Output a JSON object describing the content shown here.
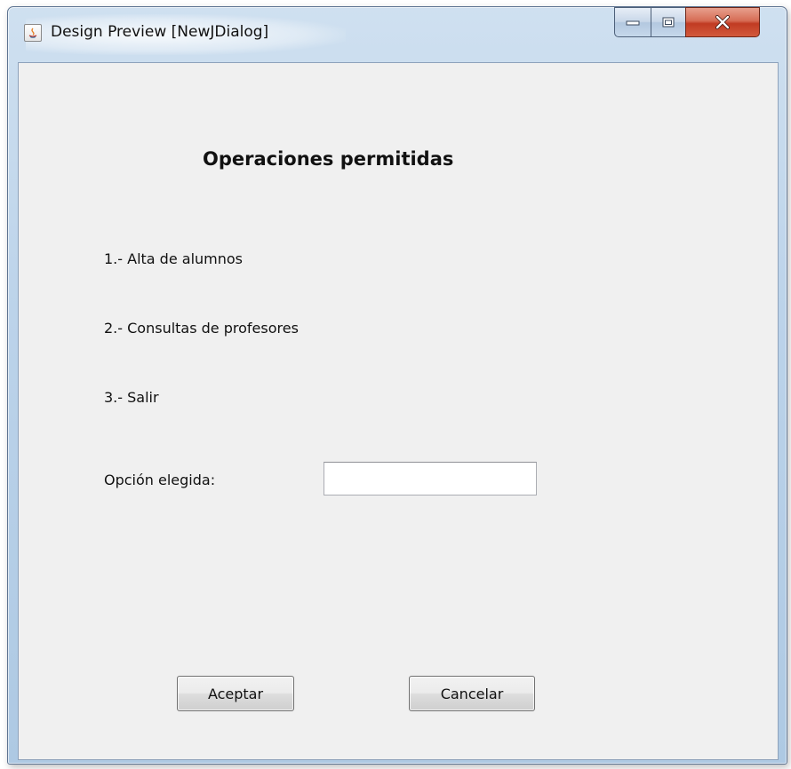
{
  "window": {
    "title": "Design Preview [NewJDialog]",
    "controls": {
      "minimize_icon": "minimize-icon",
      "maximize_icon": "maximize-icon",
      "close_icon": "close-icon"
    }
  },
  "dialog": {
    "heading": "Operaciones permitidas",
    "options": [
      "1.- Alta de alumnos",
      "2.- Consultas de profesores",
      "3.- Salir"
    ],
    "option_label": "Opción elegida:",
    "option_input_value": "",
    "accept_label": "Aceptar",
    "cancel_label": "Cancelar"
  },
  "colors": {
    "client_background": "#f0f0f0",
    "titlebar_tint": "#bcd3ea",
    "close_button": "#c13b22"
  }
}
